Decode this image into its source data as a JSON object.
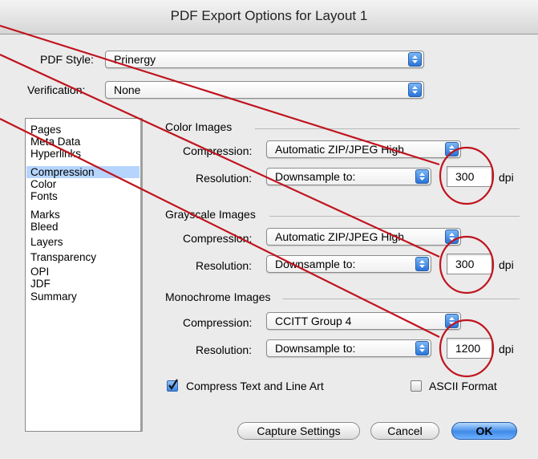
{
  "window": {
    "title": "PDF Export Options for Layout 1"
  },
  "pdf_style": {
    "label": "PDF Style:",
    "value": "Prinergy"
  },
  "verification": {
    "label": "Verification:",
    "value": "None"
  },
  "sidebar": {
    "items": [
      "Pages",
      "Meta Data",
      "Hyperlinks",
      "Compression",
      "Color",
      "Fonts",
      "Marks",
      "Bleed",
      "Layers",
      "Transparency",
      "OPI",
      "JDF",
      "Summary"
    ],
    "selected": "Compression"
  },
  "color_images": {
    "title": "Color Images",
    "compression_label": "Compression:",
    "compression_value": "Automatic ZIP/JPEG High",
    "resolution_label": "Resolution:",
    "resolution_value": "Downsample to:",
    "dpi_value": "300",
    "dpi_unit": "dpi"
  },
  "grayscale_images": {
    "title": "Grayscale Images",
    "compression_label": "Compression:",
    "compression_value": "Automatic ZIP/JPEG High",
    "resolution_label": "Resolution:",
    "resolution_value": "Downsample to:",
    "dpi_value": "300",
    "dpi_unit": "dpi"
  },
  "monochrome_images": {
    "title": "Monochrome Images",
    "compression_label": "Compression:",
    "compression_value": "CCITT Group 4",
    "resolution_label": "Resolution:",
    "resolution_value": "Downsample to:",
    "dpi_value": "1200",
    "dpi_unit": "dpi"
  },
  "options": {
    "compress_text": {
      "label": "Compress Text and Line Art",
      "checked": true
    },
    "ascii_format": {
      "label": "ASCII Format",
      "checked": false
    }
  },
  "buttons": {
    "capture": "Capture Settings",
    "cancel": "Cancel",
    "ok": "OK"
  },
  "annotation_color": "#c0141e"
}
